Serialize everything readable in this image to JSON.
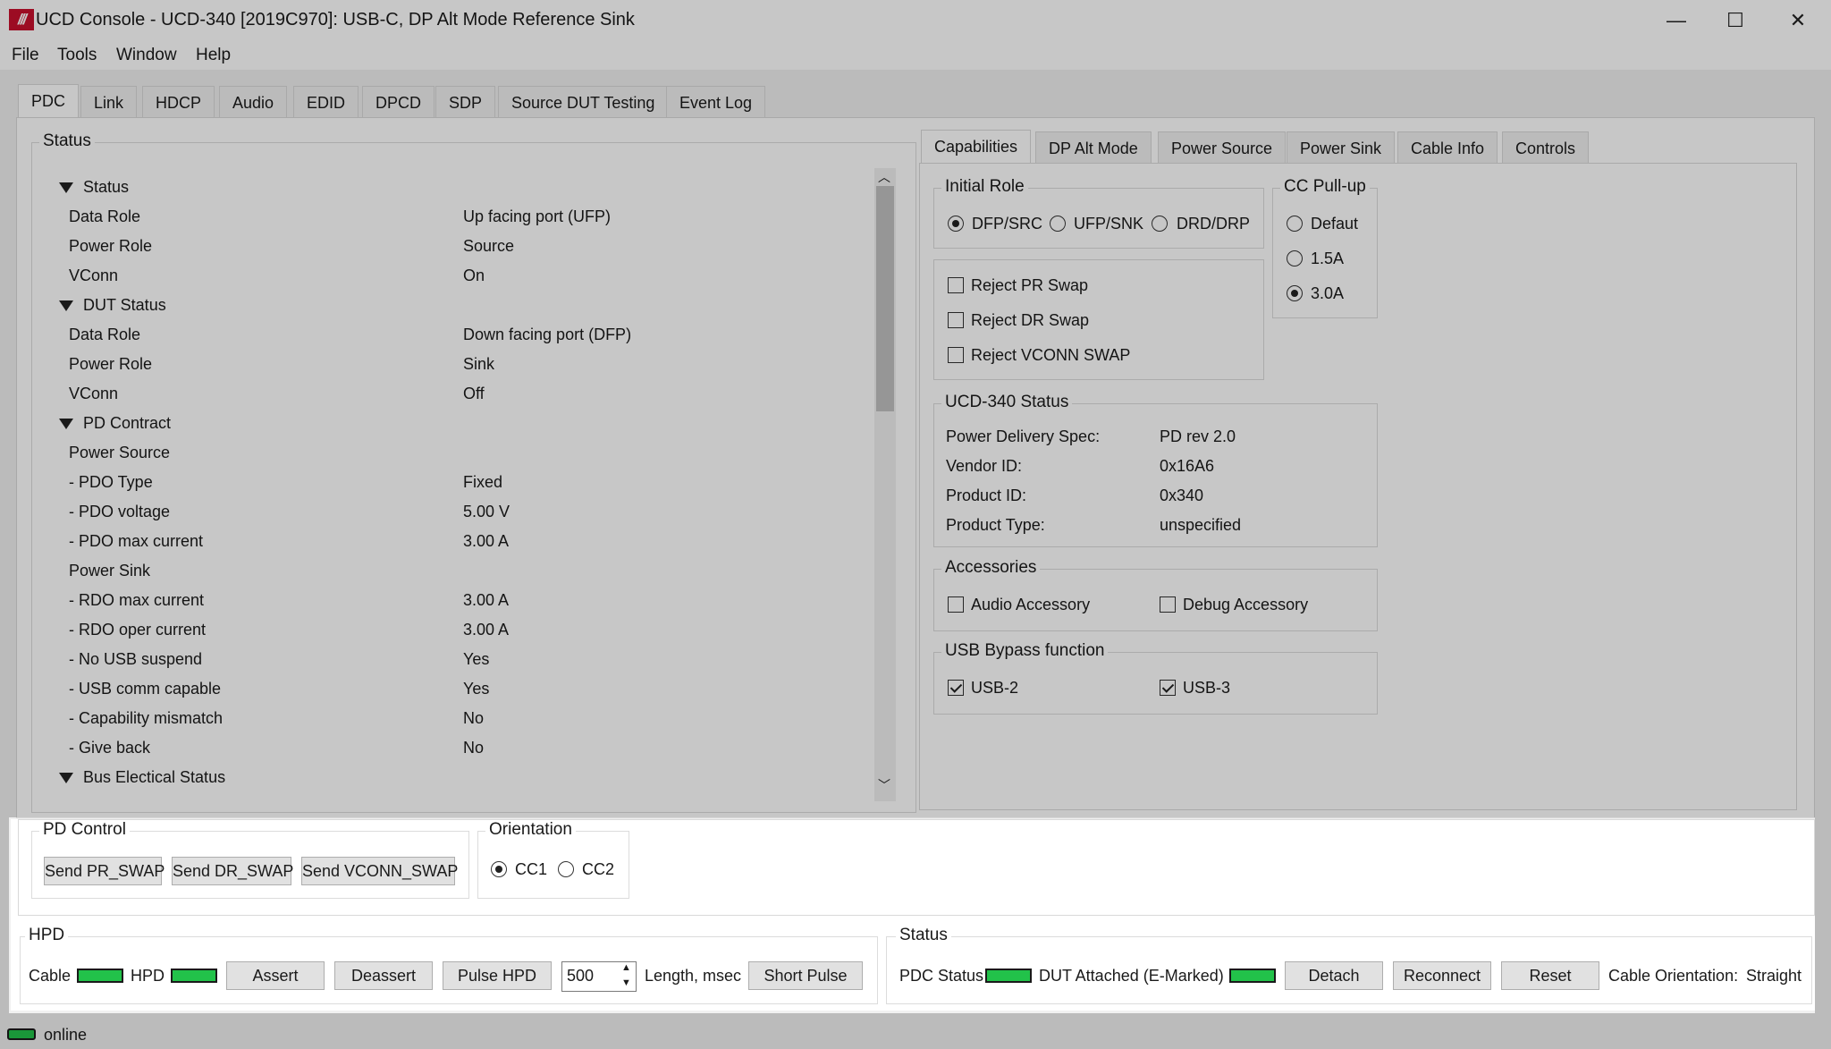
{
  "window": {
    "title": "UCD Console - UCD-340 [2019C970]: USB-C, DP Alt Mode Reference Sink",
    "logo_text": "///",
    "minimize": "—",
    "maximize": "☐",
    "close": "✕"
  },
  "menu": [
    "File",
    "Tools",
    "Window",
    "Help"
  ],
  "tabs": [
    "PDC",
    "Link",
    "HDCP",
    "Audio",
    "EDID",
    "DPCD",
    "SDP",
    "Source DUT Testing",
    "Event Log"
  ],
  "status_panel": {
    "title": "Status",
    "sections": [
      {
        "heading": "Status",
        "rows": [
          {
            "label": "Data Role",
            "value": "Up facing port (UFP)"
          },
          {
            "label": "Power Role",
            "value": "Source"
          },
          {
            "label": "VConn",
            "value": "On"
          }
        ]
      },
      {
        "heading": "DUT Status",
        "rows": [
          {
            "label": "Data Role",
            "value": "Down facing port (DFP)"
          },
          {
            "label": "Power Role",
            "value": "Sink"
          },
          {
            "label": "VConn",
            "value": "Off"
          }
        ]
      },
      {
        "heading": "PD Contract",
        "rows": [
          {
            "label": "Power Source",
            "value": ""
          },
          {
            "label": "- PDO Type",
            "value": "Fixed"
          },
          {
            "label": "- PDO voltage",
            "value": "5.00 V"
          },
          {
            "label": "- PDO max current",
            "value": "3.00 A"
          },
          {
            "label": "Power Sink",
            "value": ""
          },
          {
            "label": "- RDO max current",
            "value": "3.00 A"
          },
          {
            "label": "- RDO oper current",
            "value": "3.00 A"
          },
          {
            "label": "- No USB suspend",
            "value": "Yes"
          },
          {
            "label": "- USB comm capable",
            "value": "Yes"
          },
          {
            "label": "- Capability mismatch",
            "value": "No"
          },
          {
            "label": "- Give back",
            "value": "No"
          }
        ]
      },
      {
        "heading": "Bus Electical Status",
        "rows": []
      }
    ]
  },
  "right_tabs": [
    "Capabilities",
    "DP Alt Mode",
    "Power Source",
    "Power Sink",
    "Cable Info",
    "Controls"
  ],
  "initial_role": {
    "title": "Initial Role",
    "options": [
      "DFP/SRC",
      "UFP/SNK",
      "DRD/DRP"
    ],
    "selected": "DFP/SRC"
  },
  "cc_pullup": {
    "title": "CC Pull-up",
    "options": [
      "Defaut",
      "1.5A",
      "3.0A"
    ],
    "selected": "3.0A"
  },
  "reject": [
    "Reject PR Swap",
    "Reject DR Swap",
    "Reject VCONN SWAP"
  ],
  "ucd_status": {
    "title": "UCD-340 Status",
    "rows": [
      {
        "label": "Power Delivery Spec:",
        "value": "PD rev 2.0"
      },
      {
        "label": "Vendor ID:",
        "value": "0x16A6"
      },
      {
        "label": "Product ID:",
        "value": "0x340"
      },
      {
        "label": "Product Type:",
        "value": "unspecified"
      }
    ]
  },
  "accessories": {
    "title": "Accessories",
    "audio": "Audio Accessory",
    "debug": "Debug Accessory"
  },
  "usb_bypass": {
    "title": "USB Bypass function",
    "usb2": "USB-2",
    "usb3": "USB-3"
  },
  "pd_control": {
    "title": "PD Control",
    "buttons": [
      "Send PR_SWAP",
      "Send DR_SWAP",
      "Send VCONN_SWAP"
    ]
  },
  "orientation": {
    "title": "Orientation",
    "options": [
      "CC1",
      "CC2"
    ],
    "selected": "CC1"
  },
  "hpd": {
    "title": "HPD",
    "cable_label": "Cable",
    "hpd_label": "HPD",
    "assert": "Assert",
    "deassert": "Deassert",
    "pulse": "Pulse HPD",
    "length_value": "500",
    "length_label": "Length, msec",
    "short_pulse": "Short Pulse"
  },
  "bottom_status": {
    "title": "Status",
    "pdc_label": "PDC Status",
    "dut_label": "DUT Attached (E-Marked)",
    "detach": "Detach",
    "reconnect": "Reconnect",
    "reset": "Reset",
    "cable_orientation_label": "Cable Orientation:",
    "cable_orientation_value": "Straight"
  },
  "statusbar": {
    "text": "online"
  },
  "colors": {
    "led": "#22c24a",
    "logo": "#c8102e"
  }
}
